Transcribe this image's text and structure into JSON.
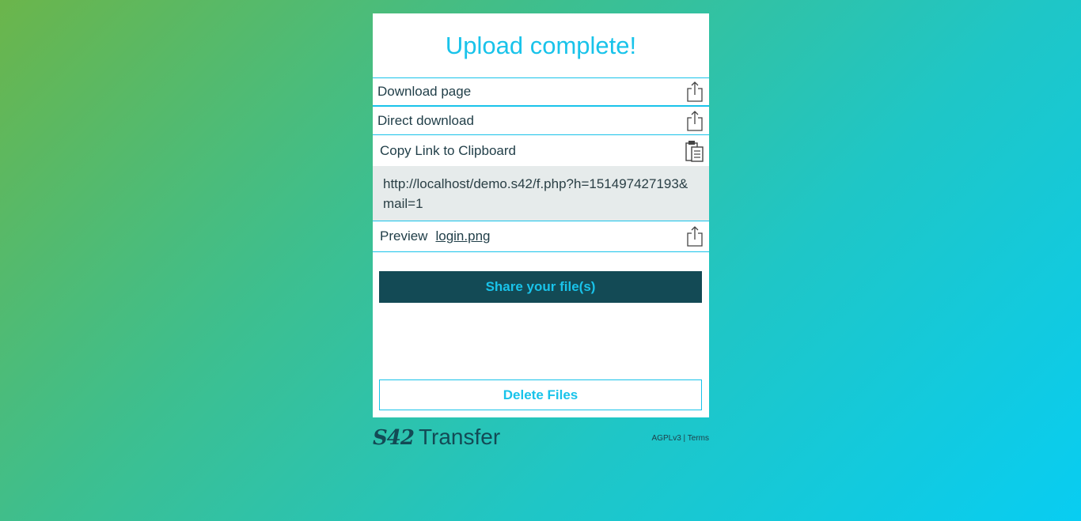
{
  "header": {
    "title": "Upload complete!"
  },
  "links": {
    "download_page": "Download page",
    "direct_download": "Direct download",
    "copy_label": "Copy Link to Clipboard",
    "url": "http://localhost/demo.s42/f.php?h=151497427193&mail=1",
    "preview_label": "Preview",
    "preview_file": "login.png"
  },
  "icons": {
    "share": "share-icon",
    "clipboard": "clipboard-icon"
  },
  "buttons": {
    "share": "Share your file(s)",
    "delete": "Delete Files"
  },
  "footer": {
    "logo_mark": "S42",
    "logo_text": "Transfer",
    "license": "AGPLv3",
    "separator": "|",
    "terms": "Terms"
  },
  "colors": {
    "accent": "#19c3ea",
    "dark": "#134a55",
    "url_bg": "#e6ebeb"
  }
}
